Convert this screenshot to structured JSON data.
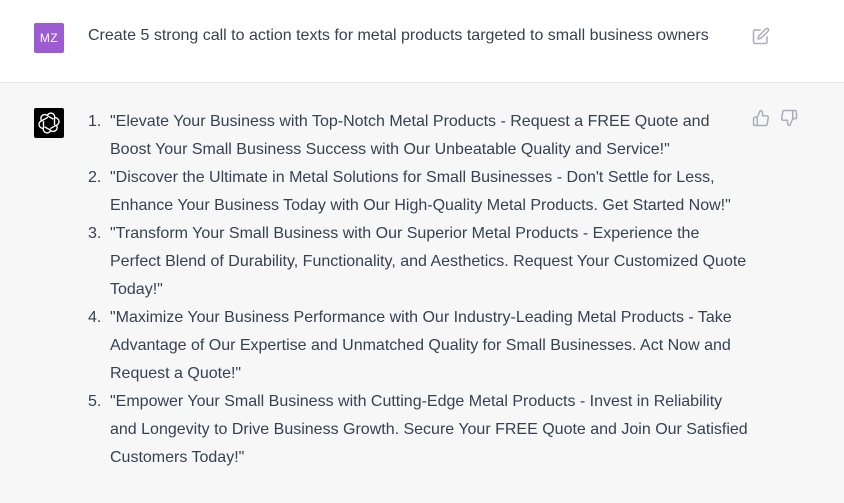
{
  "user": {
    "avatar_initials": "MZ",
    "avatar_color": "#9d5bd2",
    "message": "Create 5 strong call to action texts for metal products targeted to small business owners"
  },
  "assistant": {
    "items": [
      {
        "number": "1.",
        "text": "\"Elevate Your Business with Top-Notch Metal Products - Request a FREE Quote and Boost Your Small Business Success with Our Unbeatable Quality and Service!\""
      },
      {
        "number": "2.",
        "text": "\"Discover the Ultimate in Metal Solutions for Small Businesses - Don't Settle for Less, Enhance Your Business Today with Our High-Quality Metal Products. Get Started Now!\""
      },
      {
        "number": "3.",
        "text": "\"Transform Your Small Business with Our Superior Metal Products - Experience the Perfect Blend of Durability, Functionality, and Aesthetics. Request Your Customized Quote Today!\""
      },
      {
        "number": "4.",
        "text": "\"Maximize Your Business Performance with Our Industry-Leading Metal Products - Take Advantage of Our Expertise and Unmatched Quality for Small Businesses. Act Now and Request a Quote!\""
      },
      {
        "number": "5.",
        "text": "\"Empower Your Small Business with Cutting-Edge Metal Products - Invest in Reliability and Longevity to Drive Business Growth. Secure Your FREE Quote and Join Our Satisfied Customers Today!\""
      }
    ]
  },
  "icons": {
    "edit": "edit-icon",
    "bot": "openai-logo-icon",
    "thumbs_up": "thumbs-up-icon",
    "thumbs_down": "thumbs-down-icon"
  },
  "colors": {
    "user_bg": "#ffffff",
    "assistant_bg": "#f7f7f8",
    "text": "#374151",
    "icon": "#acacbe"
  }
}
